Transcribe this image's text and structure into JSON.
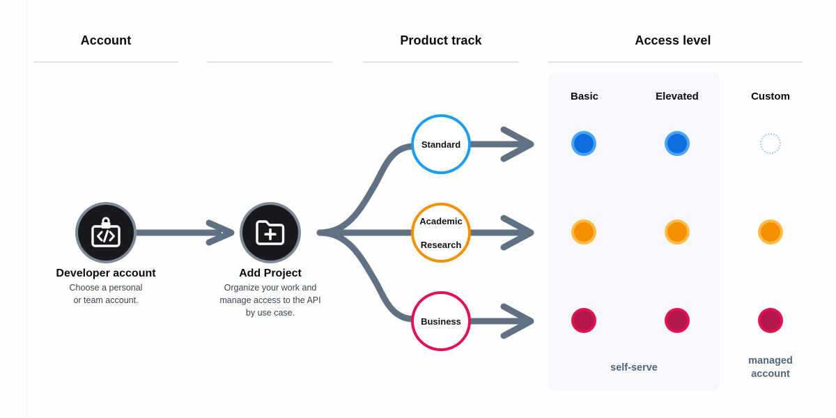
{
  "columns": [
    {
      "title": "Account"
    },
    {
      "title": "Product track"
    },
    {
      "title": "Access level"
    }
  ],
  "nodes": [
    {
      "icon": "code-badge-lock-icon",
      "title": "Developer account",
      "desc_line1": "Choose a personal",
      "desc_line2": "or team account."
    },
    {
      "icon": "folder-plus-icon",
      "title": "Add Project",
      "desc_line1": "Organize your work and",
      "desc_line2": "manage access to the API",
      "desc_line3": "by use case."
    }
  ],
  "tracks": [
    {
      "label": "Standard",
      "label_line2": "",
      "color": "#1b9df0"
    },
    {
      "label": "Academic",
      "label_line2": "Research",
      "color": "#f59100"
    },
    {
      "label": "Business",
      "label_line2": "",
      "color": "#e0124f"
    }
  ],
  "access": {
    "columns": [
      "Basic",
      "Elevated",
      "Custom"
    ],
    "rows": [
      {
        "track": "Standard",
        "color": "#0d6ee0",
        "ring": "#4aa5f0",
        "cells": [
          "filled",
          "filled",
          "dotted"
        ]
      },
      {
        "track": "Academic Research",
        "color": "#f59100",
        "ring": "#ffbb45",
        "cells": [
          "filled",
          "filled",
          "filled"
        ]
      },
      {
        "track": "Business",
        "color": "#b5164b",
        "ring": "#e0124f",
        "cells": [
          "filled",
          "filled",
          "filled"
        ]
      }
    ],
    "footnote_self_serve": "self-serve",
    "footnote_managed_line1": "managed",
    "footnote_managed_line2": "account"
  },
  "colors": {
    "connector": "#5f7183",
    "node_fill": "#17191c",
    "node_border": "#7d8996",
    "panel_bg": "#f6f7fa",
    "rule": "#dfe3ea"
  }
}
